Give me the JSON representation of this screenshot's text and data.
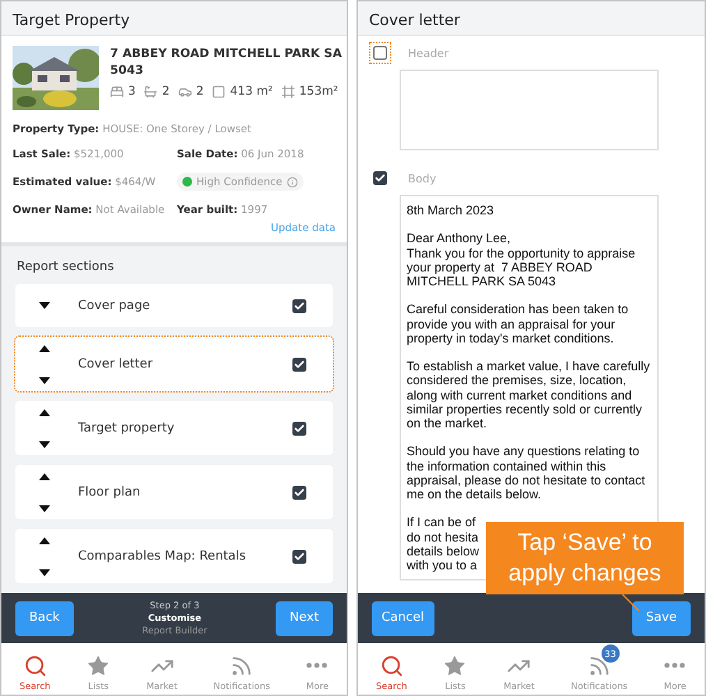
{
  "left_screen": {
    "title": "Target Property",
    "property": {
      "address": "7 ABBEY ROAD MITCHELL PARK SA 5043",
      "features": [
        {
          "kind": "bed",
          "value": "3"
        },
        {
          "kind": "bath",
          "value": "2"
        },
        {
          "kind": "car",
          "value": "2"
        },
        {
          "kind": "land",
          "value": "413 m²"
        },
        {
          "kind": "floor",
          "value": "153m²"
        }
      ],
      "detail_rows": [
        [
          {
            "kind": "field",
            "label": "Property Type:",
            "value": "HOUSE: One Storey / Lowset"
          }
        ],
        [
          {
            "kind": "field",
            "label": "Last Sale:",
            "value": "$521,000"
          },
          {
            "kind": "field",
            "label": "Sale Date:",
            "value": "06 Jun 2018"
          }
        ],
        [
          {
            "kind": "field",
            "label": "Estimated value:",
            "value": "$464/W"
          },
          {
            "kind": "confidence",
            "value": "High Confidence",
            "color": "#2eb84b"
          }
        ],
        [
          {
            "kind": "field",
            "label": "Owner Name:",
            "value": "Not Available"
          },
          {
            "kind": "field",
            "label": "Year built:",
            "value": "1997"
          }
        ]
      ],
      "link": "Update data"
    },
    "sections_title": "Report sections",
    "sections": [
      {
        "label": "Cover page",
        "kind": "first",
        "checked": true,
        "highlighted": false
      },
      {
        "label": "Cover letter",
        "kind": "movable",
        "checked": true,
        "highlighted": true
      },
      {
        "label": "Target property",
        "kind": "movable",
        "checked": true,
        "highlighted": false
      },
      {
        "label": "Floor plan",
        "kind": "movable",
        "checked": true,
        "highlighted": false
      },
      {
        "label": "Comparables Map: Rentals",
        "kind": "movable",
        "checked": true,
        "highlighted": false
      }
    ],
    "footer": {
      "back": "Back",
      "step": "Step 2 of 3",
      "stage": "Customise",
      "subtitle": "Report Builder",
      "next": "Next"
    },
    "tab_bar": [
      {
        "kind": "search",
        "label": "Search",
        "selected": true
      },
      {
        "kind": "star",
        "label": "Lists",
        "selected": false
      },
      {
        "kind": "market",
        "label": "Market",
        "selected": false
      },
      {
        "kind": "feed",
        "label": "Notifications",
        "selected": false
      },
      {
        "kind": "more",
        "label": "More",
        "selected": false
      }
    ]
  },
  "right_screen": {
    "title": "Cover letter",
    "fields": [
      {
        "label": "Header",
        "checked": false,
        "highlighted": true
      },
      {
        "label": "Body",
        "checked": true,
        "highlighted": false,
        "value": "8th March 2023\n\nDear Anthony Lee,\nThank you for the opportunity to appraise your property at  7 ABBEY ROAD MITCHELL PARK SA 5043\n\nCareful consideration has been taken to provide you with an appraisal for your property in today's market conditions.\n\nTo establish a market value, I have carefully considered the premises, size, location, along with current market conditions and similar properties recently sold or currently on the market.\n\nShould you have any questions relating to the information contained within this appraisal, please do not hesitate to contact me on the details below.\n\nIf I can be of\ndo not hesita\ndetails below\nwith you to a"
      }
    ],
    "callout": "Tap ‘Save’ to apply changes",
    "footer": {
      "cancel": "Cancel",
      "save": "Save"
    },
    "tab_bar": [
      {
        "kind": "search",
        "label": "Search",
        "selected": true
      },
      {
        "kind": "star",
        "label": "Lists",
        "selected": false
      },
      {
        "kind": "market",
        "label": "Market",
        "selected": false
      },
      {
        "kind": "feed",
        "label": "Notifications",
        "selected": false,
        "badge": "33"
      },
      {
        "kind": "more",
        "label": "More",
        "selected": false
      }
    ]
  }
}
